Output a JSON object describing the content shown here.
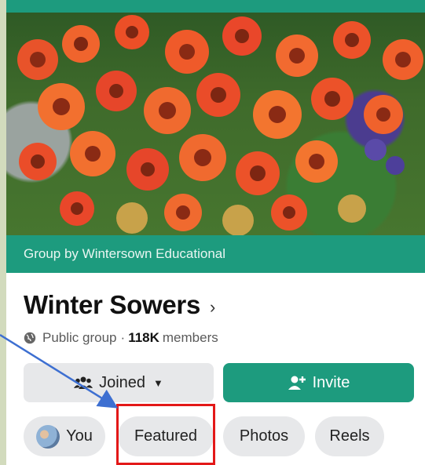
{
  "group": {
    "byline": "Group by Wintersown Educational",
    "name": "Winter Sowers",
    "chevron": "›",
    "privacy": "Public group",
    "separator": "·",
    "member_count": "118K",
    "member_word": "members"
  },
  "actions": {
    "joined_label": "Joined",
    "joined_caret": "▼",
    "invite_label": "Invite"
  },
  "tabs": [
    "You",
    "Featured",
    "Photos",
    "Reels"
  ],
  "icons": [
    "globe-icon",
    "people-icon",
    "add-person-icon",
    "caret-down-icon",
    "chevron-right-icon"
  ],
  "colors": {
    "brand_green": "#1d9b7e",
    "chip_gray": "#e7e8ea",
    "highlight_red": "#e31818",
    "annotation_arrow": "#3d6fd1"
  }
}
